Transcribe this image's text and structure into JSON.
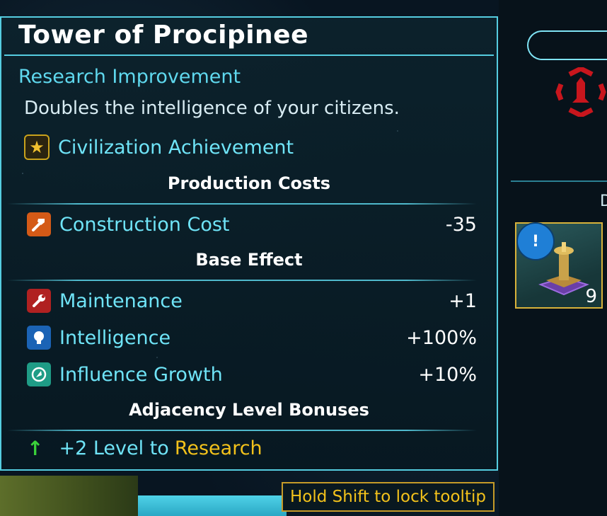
{
  "tooltip": {
    "title": "Tower of Procipinee",
    "subtitle": "Research Improvement",
    "description": "Doubles the intelligence of your citizens.",
    "achievement": {
      "label": "Civilization Achievement",
      "icon": "star-icon"
    },
    "production": {
      "heading": "Production Costs",
      "rows": [
        {
          "label": "Construction Cost",
          "value": "-35",
          "icon": "hammer-icon",
          "color": "#d45a17"
        }
      ]
    },
    "base_effect": {
      "heading": "Base Effect",
      "rows": [
        {
          "label": "Maintenance",
          "value": "+1",
          "icon": "wrench-icon",
          "color": "#b02121"
        },
        {
          "label": "Intelligence",
          "value": "+100%",
          "icon": "lightbulb-icon",
          "color": "#1b63b5"
        },
        {
          "label": "Influence Growth",
          "value": "+10%",
          "icon": "influence-icon",
          "color": "#1f9c86"
        }
      ]
    },
    "adjacency": {
      "heading": "Adjacency Level Bonuses",
      "bonus_prefix": "+2 Level to ",
      "bonus_target": "Research",
      "icon": "up-arrow-icon"
    }
  },
  "hint": "Hold Shift to lock tooltip",
  "side_panel": {
    "partial_label": "D",
    "card": {
      "badge_icon": "research-alert-icon",
      "badge_text": "!",
      "count": "9"
    }
  },
  "colors": {
    "accent": "#55cde0",
    "label": "#6fe4f7",
    "highlight": "#f3c21b"
  }
}
